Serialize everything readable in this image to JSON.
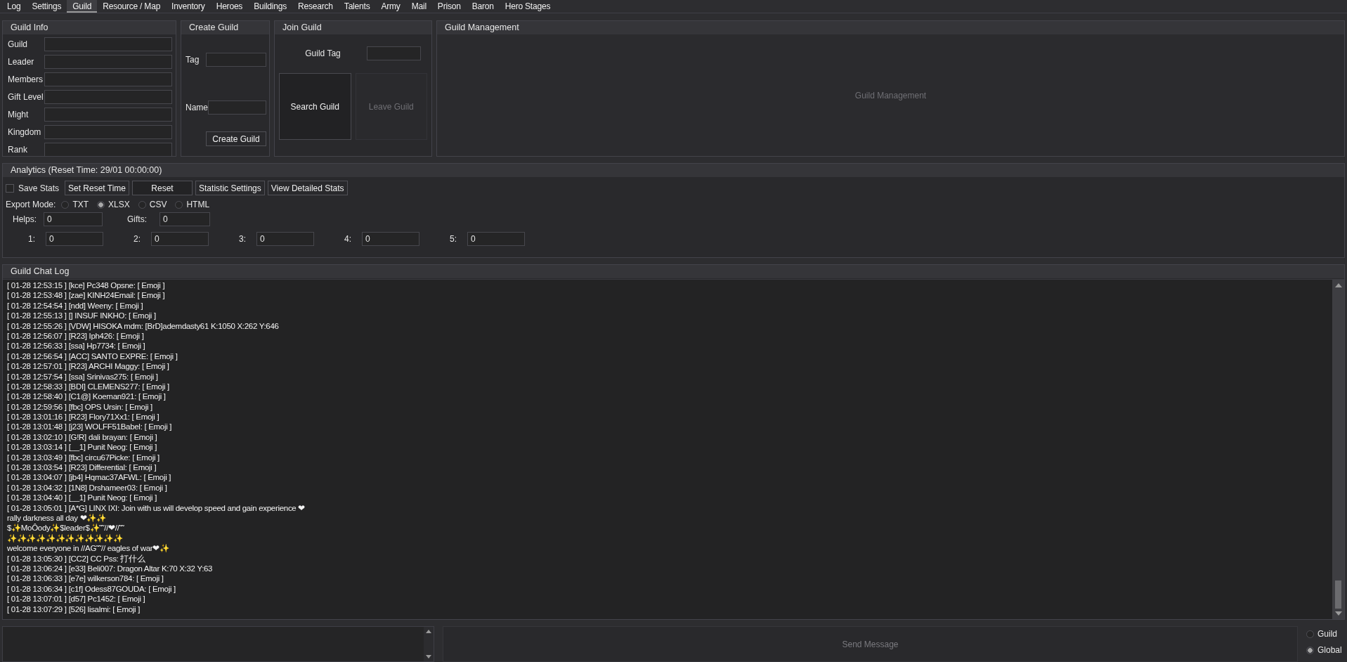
{
  "tabs": [
    {
      "label": "Log",
      "selected": false
    },
    {
      "label": "Settings",
      "selected": false
    },
    {
      "label": "Guild",
      "selected": true
    },
    {
      "label": "Resource / Map",
      "selected": false
    },
    {
      "label": "Inventory",
      "selected": false
    },
    {
      "label": "Heroes",
      "selected": false
    },
    {
      "label": "Buildings",
      "selected": false
    },
    {
      "label": "Research",
      "selected": false
    },
    {
      "label": "Talents",
      "selected": false
    },
    {
      "label": "Army",
      "selected": false
    },
    {
      "label": "Mail",
      "selected": false
    },
    {
      "label": "Prison",
      "selected": false
    },
    {
      "label": "Baron",
      "selected": false
    },
    {
      "label": "Hero Stages",
      "selected": false
    }
  ],
  "guild_info": {
    "title": "Guild Info",
    "fields": [
      {
        "label": "Guild"
      },
      {
        "label": "Leader"
      },
      {
        "label": "Members"
      },
      {
        "label": "Gift Level"
      },
      {
        "label": "Might"
      },
      {
        "label": "Kingdom"
      },
      {
        "label": "Rank"
      }
    ]
  },
  "create_guild": {
    "title": "Create Guild",
    "fields": [
      {
        "label": "Tag"
      },
      {
        "label": "Name"
      }
    ],
    "button": "Create Guild"
  },
  "join_guild": {
    "title": "Join Guild",
    "field_label": "Guild Tag",
    "search_button": {
      "label": "Search Guild",
      "disabled": false
    },
    "leave_button": {
      "label": "Leave Guild",
      "disabled": true
    }
  },
  "guild_management": {
    "title": "Guild Management",
    "button": {
      "label": "Guild Management",
      "disabled": true
    }
  },
  "analytics": {
    "title": "Analytics (Reset Time: 29/01 00:00:00)",
    "save_stats": {
      "label": "Save Stats",
      "checked": false
    },
    "buttons": [
      "Set Reset Time",
      "Reset",
      "Statistic Settings",
      "View Detailed Stats"
    ],
    "export_mode": {
      "label": "Export Mode:",
      "options": [
        {
          "label": "TXT",
          "selected": false
        },
        {
          "label": "XLSX",
          "selected": true
        },
        {
          "label": "CSV",
          "selected": false
        },
        {
          "label": "HTML",
          "selected": false
        }
      ]
    },
    "helps": {
      "label": "Helps:",
      "value": "0"
    },
    "gifts": {
      "label": "Gifts:",
      "value": "0"
    },
    "ranks": [
      {
        "label": "1:",
        "value": "0"
      },
      {
        "label": "2:",
        "value": "0"
      },
      {
        "label": "3:",
        "value": "0"
      },
      {
        "label": "4:",
        "value": "0"
      },
      {
        "label": "5:",
        "value": "0"
      }
    ]
  },
  "chat_log": {
    "title": "Guild Chat Log",
    "lines": [
      "[ 01-28 12:53:15 ] [kce] Pc348 Opsne: [ Emoji ]",
      "[ 01-28 12:53:48 ] [zae] KINH24Email: [ Emoji ]",
      "[ 01-28 12:54:54 ] [ndd] Weeny: [ Emoji ]",
      "[ 01-28 12:55:13 ] [] INSUF INKHO: [ Emoji ]",
      "[ 01-28 12:55:26 ] [VDW] HISOKA mdm: [BrD]ademdasty61 K:1050 X:262 Y:646",
      "[ 01-28 12:56:07 ] [R23] Iph426: [ Emoji ]",
      "[ 01-28 12:56:33 ] [ssa] Hp7734: [ Emoji ]",
      "[ 01-28 12:56:54 ] [ACC] SANTO EXPRE: [ Emoji ]",
      "[ 01-28 12:57:01 ] [R23] ARCHI Maggy: [ Emoji ]",
      "[ 01-28 12:57:54 ] [ssa] Srinivas275: [ Emoji ]",
      "[ 01-28 12:58:33 ] [BDI] CLEMENS277: [ Emoji ]",
      "[ 01-28 12:58:40 ] [C1@] Koeman921: [ Emoji ]",
      "[ 01-28 12:59:56 ] [fbc] OPS Ursin: [ Emoji ]",
      "[ 01-28 13:01:16 ] [R23] Flory71Xx1: [ Emoji ]",
      "[ 01-28 13:01:48 ] [j23] WOLFF51Babel: [ Emoji ]",
      "[ 01-28 13:02:10 ] [G!R] dali brayan: [ Emoji ]",
      "[ 01-28 13:03:14 ] [__1] Punit Neog: [ Emoji ]",
      "[ 01-28 13:03:49 ] [fbc] circu67Picke: [ Emoji ]",
      "[ 01-28 13:03:54 ] [R23] Differential: [ Emoji ]",
      "[ 01-28 13:04:07 ] [jb4] Hqmac37AFWL: [ Emoji ]",
      "[ 01-28 13:04:32 ] [1N8] Drshameer03: [ Emoji ]",
      "[ 01-28 13:04:40 ] [__1] Punit Neog: [ Emoji ]",
      "[ 01-28 13:05:01 ] [A*G] LINX IXI: Join with us will develop speed and gain experience  ❤",
      "rally darkness all day ❤✨✨",
      "$✨MoÔody✨$leader$✨˜˜//❤//˜˜",
      "✨✨✨✨✨✨✨✨✨✨✨✨",
      "welcome everyone in //AG˜˜// eagles of war❤✨",
      "[ 01-28 13:05:30 ] [CC2] CC Pss: 打什么",
      "[ 01-28 13:06:24 ] [e33] Beli007: Dragon Altar K:70 X:32 Y:63",
      "[ 01-28 13:06:33 ] [e7e] wilkerson784: [ Emoji ]",
      "[ 01-28 13:06:34 ] [c1f] Odess87GOUDA: [ Emoji ]",
      "[ 01-28 13:07:01 ] [d57] Pc1452: [ Emoji ]",
      "[ 01-28 13:07:29 ] [526] lisalmi: [ Emoji ]"
    ]
  },
  "composer": {
    "send_button": {
      "label": "Send Message",
      "disabled": true
    },
    "channels": [
      {
        "label": "Guild",
        "selected": false
      },
      {
        "label": "Global",
        "selected": true
      }
    ]
  }
}
